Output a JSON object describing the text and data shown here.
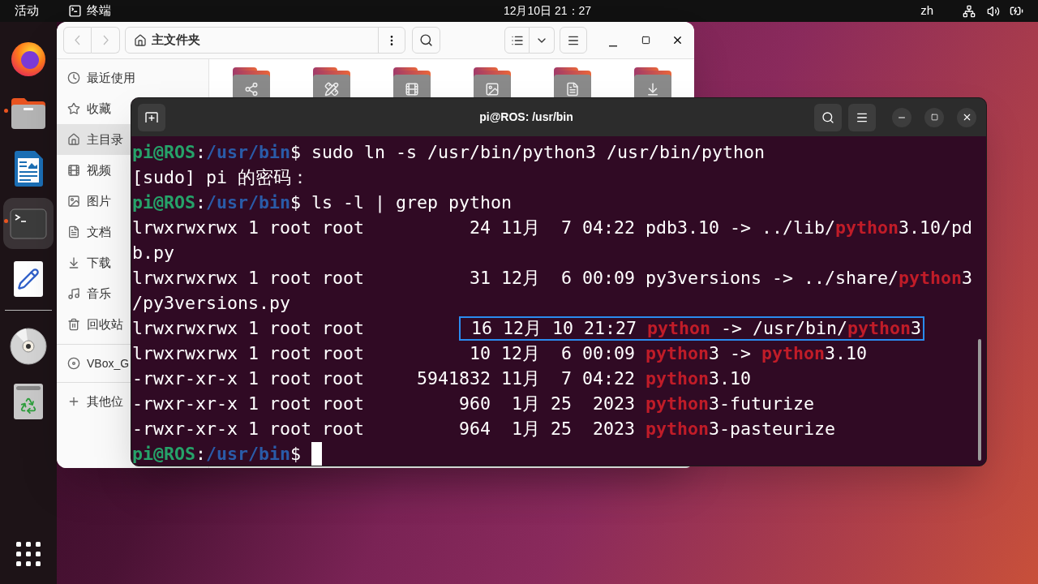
{
  "top_bar": {
    "activities": "活动",
    "app_name": "终端",
    "clock": "12月10日 21：27",
    "input_method": "zh"
  },
  "dock": [
    {
      "running": false,
      "selected": false
    },
    {
      "running": true,
      "selected": false
    },
    {
      "running": false,
      "selected": false
    },
    {
      "running": true,
      "selected": true
    },
    {
      "running": false,
      "selected": false
    },
    {
      "running": false,
      "selected": false
    },
    {
      "running": false,
      "selected": false
    }
  ],
  "files_window": {
    "path": "主文件夹",
    "sidebar": [
      {
        "label": "最近使用",
        "selected": false
      },
      {
        "label": "收藏",
        "selected": false
      },
      {
        "label": "主目录",
        "selected": true
      },
      {
        "label": "视频",
        "selected": false
      },
      {
        "label": "图片",
        "selected": false
      },
      {
        "label": "文档",
        "selected": false
      },
      {
        "label": "下载",
        "selected": false
      },
      {
        "label": "音乐",
        "selected": false
      },
      {
        "label": "回收站",
        "selected": false
      }
    ],
    "device": "VBox_G",
    "other_locations": "其他位"
  },
  "terminal_window": {
    "title": "pi@ROS: /usr/bin",
    "cursor": true,
    "lines": [
      {
        "segments": [
          {
            "kind": "user",
            "text": "pi@ROS"
          },
          {
            "kind": "plain",
            "text": ":"
          },
          {
            "kind": "path",
            "text": "/usr/bin"
          },
          {
            "kind": "plain",
            "text": "$ sudo ln -s /usr/bin/python3 /usr/bin/python"
          }
        ]
      },
      {
        "segments": [
          {
            "kind": "plain",
            "text": "[sudo] pi 的密码："
          }
        ]
      },
      {
        "segments": [
          {
            "kind": "user",
            "text": "pi@ROS"
          },
          {
            "kind": "plain",
            "text": ":"
          },
          {
            "kind": "path",
            "text": "/usr/bin"
          },
          {
            "kind": "plain",
            "text": "$ ls -l | grep python"
          }
        ]
      },
      {
        "segments": [
          {
            "kind": "plain",
            "text": "lrwxrwxrwx 1 root root          24 11月  7 04:22 pdb3.10 -> ../lib/"
          },
          {
            "kind": "match",
            "text": "python"
          },
          {
            "kind": "plain",
            "text": "3.10/pd"
          }
        ]
      },
      {
        "segments": [
          {
            "kind": "plain",
            "text": "b.py"
          }
        ]
      },
      {
        "segments": [
          {
            "kind": "plain",
            "text": "lrwxrwxrwx 1 root root          31 12月  6 00:09 py3versions -> ../share/"
          },
          {
            "kind": "match",
            "text": "python"
          },
          {
            "kind": "plain",
            "text": "3"
          }
        ]
      },
      {
        "segments": [
          {
            "kind": "plain",
            "text": "/py3versions.py"
          }
        ]
      },
      {
        "segments": [
          {
            "kind": "plain",
            "text": "lrwxrwxrwx 1 root root         "
          }
        ],
        "boxed": [
          {
            "kind": "plain",
            "text": " 16 12月 10 21:27 "
          },
          {
            "kind": "match",
            "text": "python"
          },
          {
            "kind": "plain",
            "text": " -> /usr/bin/"
          },
          {
            "kind": "match",
            "text": "python"
          },
          {
            "kind": "plain",
            "text": "3"
          }
        ]
      },
      {
        "segments": [
          {
            "kind": "plain",
            "text": "lrwxrwxrwx 1 root root          10 12月  6 00:09 "
          },
          {
            "kind": "match",
            "text": "python"
          },
          {
            "kind": "plain",
            "text": "3 -> "
          },
          {
            "kind": "match",
            "text": "python"
          },
          {
            "kind": "plain",
            "text": "3.10"
          }
        ]
      },
      {
        "segments": [
          {
            "kind": "plain",
            "text": "-rwxr-xr-x 1 root root     5941832 11月  7 04:22 "
          },
          {
            "kind": "match",
            "text": "python"
          },
          {
            "kind": "plain",
            "text": "3.10"
          }
        ]
      },
      {
        "segments": [
          {
            "kind": "plain",
            "text": "-rwxr-xr-x 1 root root         960  1月 25  2023 "
          },
          {
            "kind": "match",
            "text": "python"
          },
          {
            "kind": "plain",
            "text": "3-futurize"
          }
        ]
      },
      {
        "segments": [
          {
            "kind": "plain",
            "text": "-rwxr-xr-x 1 root root         964  1月 25  2023 "
          },
          {
            "kind": "match",
            "text": "python"
          },
          {
            "kind": "plain",
            "text": "3-pasteurize"
          }
        ]
      },
      {
        "segments": [
          {
            "kind": "user",
            "text": "pi@ROS"
          },
          {
            "kind": "plain",
            "text": ":"
          },
          {
            "kind": "path",
            "text": "/usr/bin"
          },
          {
            "kind": "plain",
            "text": "$ "
          }
        ]
      }
    ]
  }
}
